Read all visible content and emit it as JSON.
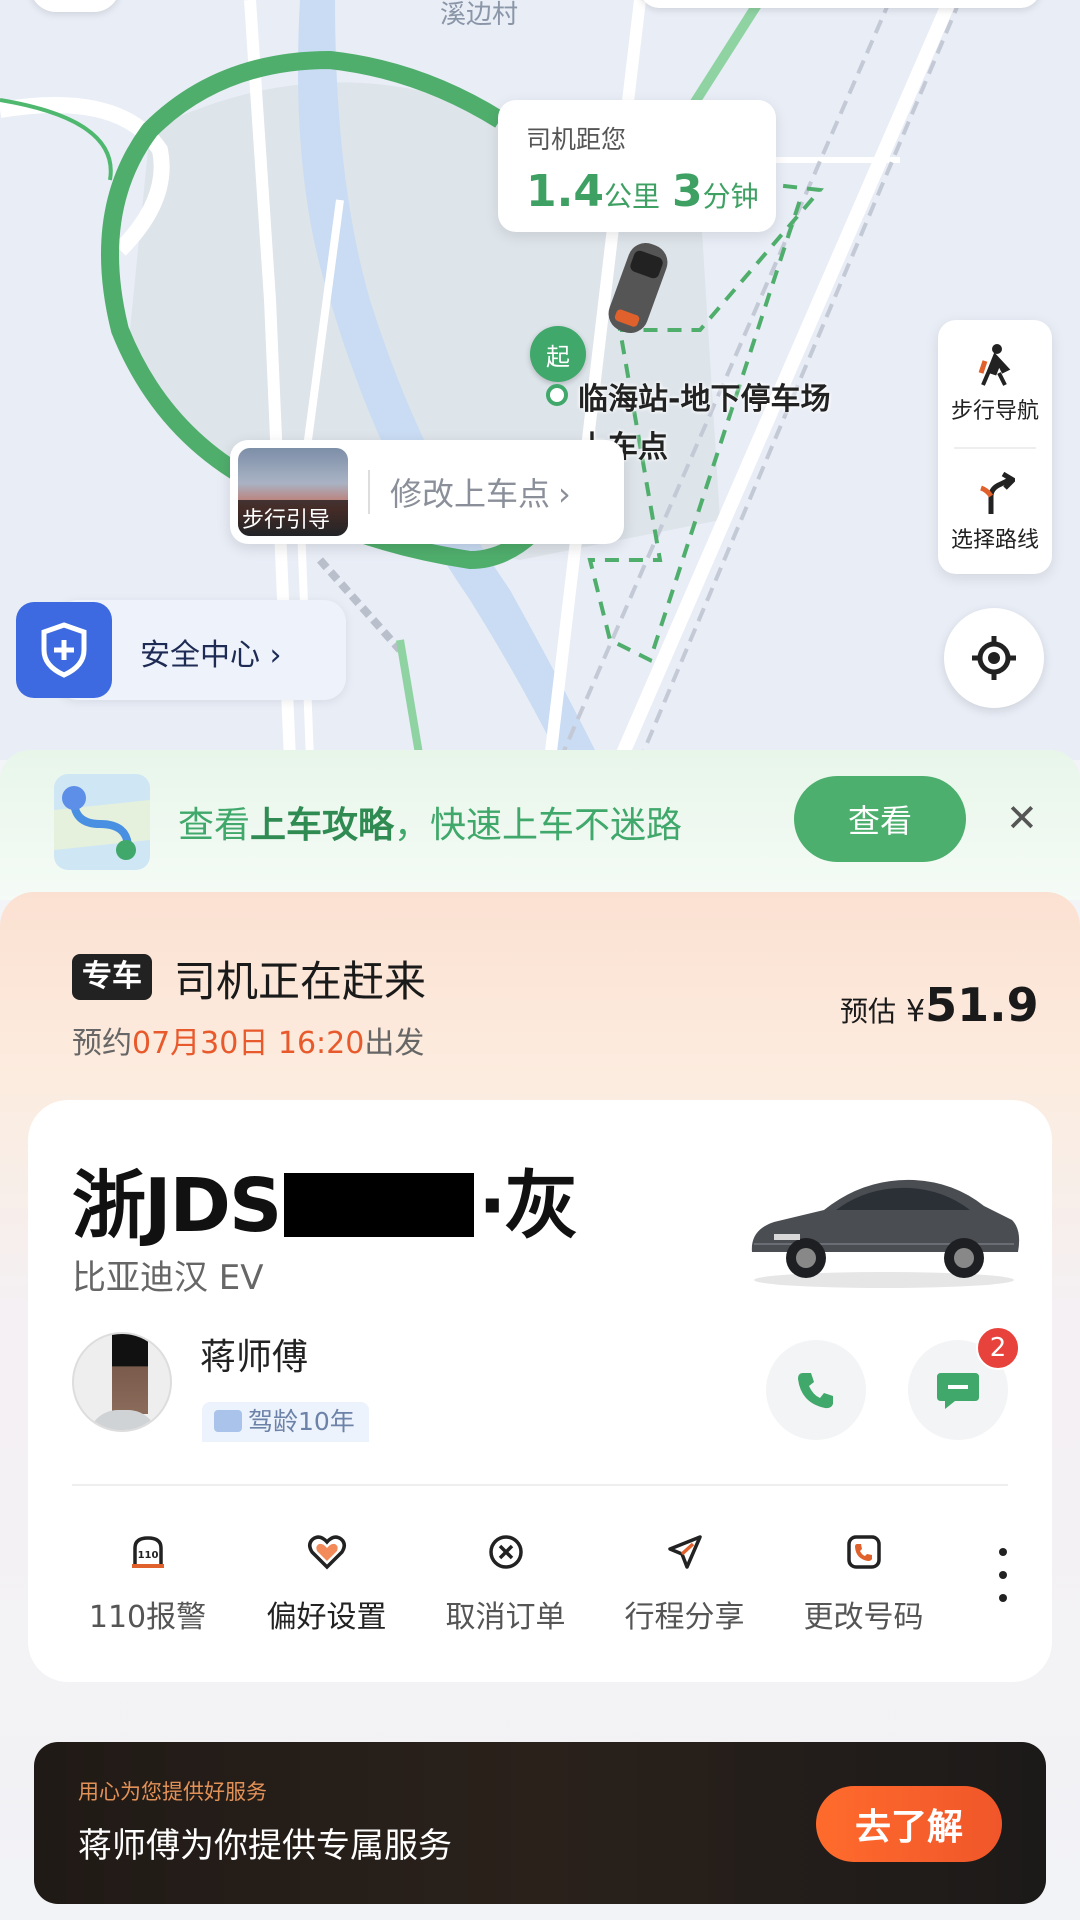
{
  "map": {
    "top_label": "溪边村",
    "distance_card": {
      "title": "司机距您",
      "distance_value": "1.4",
      "distance_unit": "公里",
      "time_value": "3",
      "time_unit": "分钟"
    },
    "start_badge": "起",
    "pickup_place": "临海站-地下停车场上车点",
    "walk_guide": {
      "thumb_label": "步行引导",
      "change_label": "修改上车点"
    },
    "tools": [
      {
        "label": "步行导航",
        "icon": "walking-person-icon"
      },
      {
        "label": "选择路线",
        "icon": "route-fork-icon"
      }
    ],
    "safety_center": "安全中心"
  },
  "guide_banner": {
    "text_prefix": "查看",
    "text_highlight": "上车攻略",
    "text_suffix": "，快速上车不迷路",
    "button": "查看"
  },
  "status": {
    "service_badge": "专车",
    "title": "司机正在赶来",
    "schedule_prefix": "预约",
    "schedule_date": "07月30日 16:20",
    "schedule_suffix": "出发",
    "estimate_label": "预估",
    "currency": "¥",
    "price": "51.9"
  },
  "driver": {
    "plate_prefix": "浙JDS",
    "plate_suffix": "·灰",
    "car_model": "比亚迪汉 EV",
    "name": "蒋师傅",
    "tag": "驾龄10年",
    "unread_count": "2"
  },
  "actions": [
    {
      "label": "110报警",
      "icon": "police-110-icon"
    },
    {
      "label": "偏好设置",
      "icon": "heart-icon"
    },
    {
      "label": "取消订单",
      "icon": "cancel-circle-icon"
    },
    {
      "label": "行程分享",
      "icon": "send-plane-icon"
    },
    {
      "label": "更改号码",
      "icon": "phone-change-icon"
    }
  ],
  "promo": {
    "subtitle": "用心为您提供好服务",
    "title": "蒋师傅为你提供专属服务",
    "button": "去了解"
  },
  "colors": {
    "route_green": "#3fa86a",
    "accent_orange": "#e85a2c",
    "shield_blue": "#3d6ae0"
  }
}
